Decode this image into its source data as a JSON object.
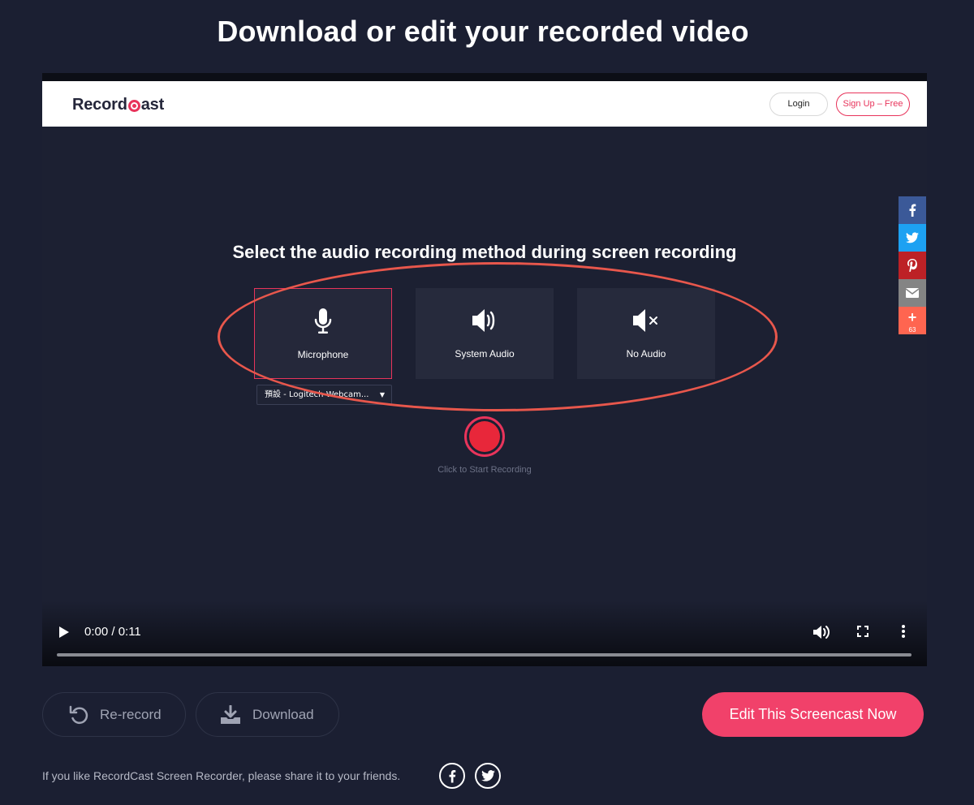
{
  "page": {
    "title": "Download or edit your recorded video"
  },
  "site": {
    "logo_text_before": "Record",
    "logo_text_after": "ast",
    "login_label": "Login",
    "signup_label": "Sign Up – Free"
  },
  "share_rail": {
    "items": [
      {
        "icon": "facebook-icon",
        "glyph": "f",
        "color": "#3b5998"
      },
      {
        "icon": "twitter-icon",
        "glyph": "t",
        "color": "#1da1f2"
      },
      {
        "icon": "pinterest-icon",
        "glyph": "P",
        "color": "#bd2126"
      },
      {
        "icon": "email-icon",
        "glyph": "✉",
        "color": "#848484"
      },
      {
        "icon": "plus-icon",
        "glyph": "+",
        "color": "#ff6550"
      }
    ],
    "count": "63"
  },
  "recorder": {
    "heading": "Select the audio recording method during screen recording",
    "options": [
      {
        "label": "Microphone",
        "icon": "microphone-icon",
        "selected": true
      },
      {
        "label": "System Audio",
        "icon": "speaker-icon",
        "selected": false
      },
      {
        "label": "No Audio",
        "icon": "mute-icon",
        "selected": false
      }
    ],
    "mic_device": "預設 - Logitech Webcam...",
    "start_hint": "Click to Start Recording",
    "accent": "#e8345b"
  },
  "video": {
    "time": "0:00 / 0:11",
    "progress": 0
  },
  "actions": {
    "rerecord_label": "Re-record",
    "download_label": "Download",
    "edit_label": "Edit This Screencast Now",
    "edit_color": "#f1416a"
  },
  "footer": {
    "share_text": "If you like RecordCast Screen Recorder, please share it to your friends."
  }
}
